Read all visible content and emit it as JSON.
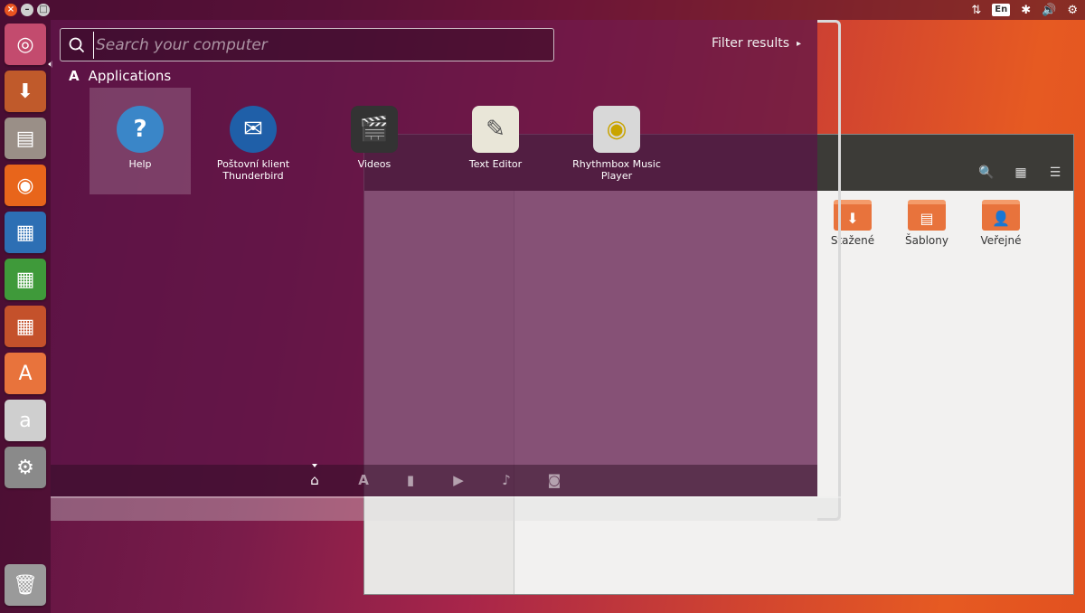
{
  "top_panel": {
    "indicators": {
      "network": "⇅",
      "keyboard_layout": "En",
      "bluetooth": "✱",
      "volume": "🔊",
      "session": "⚙"
    }
  },
  "launcher": {
    "items": [
      {
        "name": "ubuntu-dash",
        "glyph": "◎",
        "color": "#c34b6e"
      },
      {
        "name": "software-updater",
        "glyph": "⬇",
        "color": "#c05a2b"
      },
      {
        "name": "files",
        "glyph": "▤",
        "color": "#9a8f87"
      },
      {
        "name": "firefox",
        "glyph": "◉",
        "color": "#e8651b"
      },
      {
        "name": "libreoffice-writer",
        "glyph": "▦",
        "color": "#2d6fb4"
      },
      {
        "name": "libreoffice-calc",
        "glyph": "▦",
        "color": "#3f9a3a"
      },
      {
        "name": "libreoffice-impress",
        "glyph": "▦",
        "color": "#c4512b"
      },
      {
        "name": "ubuntu-software",
        "glyph": "A",
        "color": "#e8733c"
      },
      {
        "name": "amazon",
        "glyph": "a",
        "color": "#cfcfcf"
      },
      {
        "name": "system-settings",
        "glyph": "⚙",
        "color": "#8a8a8a"
      },
      {
        "name": "trash",
        "glyph": "🗑",
        "color": "#9a9a9a"
      }
    ]
  },
  "search": {
    "placeholder": "Search your computer"
  },
  "filter_results": {
    "label": "Filter results",
    "arrow": "▸"
  },
  "section": {
    "title": "Applications"
  },
  "apps": [
    {
      "label": "Help",
      "glyph": "?",
      "color": "#3a86c8"
    },
    {
      "label": "Poštovní klient Thunderbird",
      "glyph": "✉",
      "color": "#1f5fa8"
    },
    {
      "label": "Videos",
      "glyph": "🎬",
      "color": "#333333"
    },
    {
      "label": "Text Editor",
      "glyph": "✎",
      "color": "#e9e6d8"
    },
    {
      "label": "Rhythmbox Music Player",
      "glyph": "◉",
      "color": "#d8d8d8"
    }
  ],
  "files_window": {
    "folders": [
      {
        "label": "Stažené",
        "glyph": "⬇"
      },
      {
        "label": "Šablony",
        "glyph": "▤"
      },
      {
        "label": "Veřejné",
        "glyph": "👤"
      }
    ],
    "header_buttons": {
      "search": "🔍",
      "grid": "▦",
      "menu": "☰"
    }
  },
  "lenses": {
    "home": "⌂",
    "applications": "A",
    "files": "▮",
    "video": "▶",
    "music": "♪",
    "photos": "◙"
  }
}
